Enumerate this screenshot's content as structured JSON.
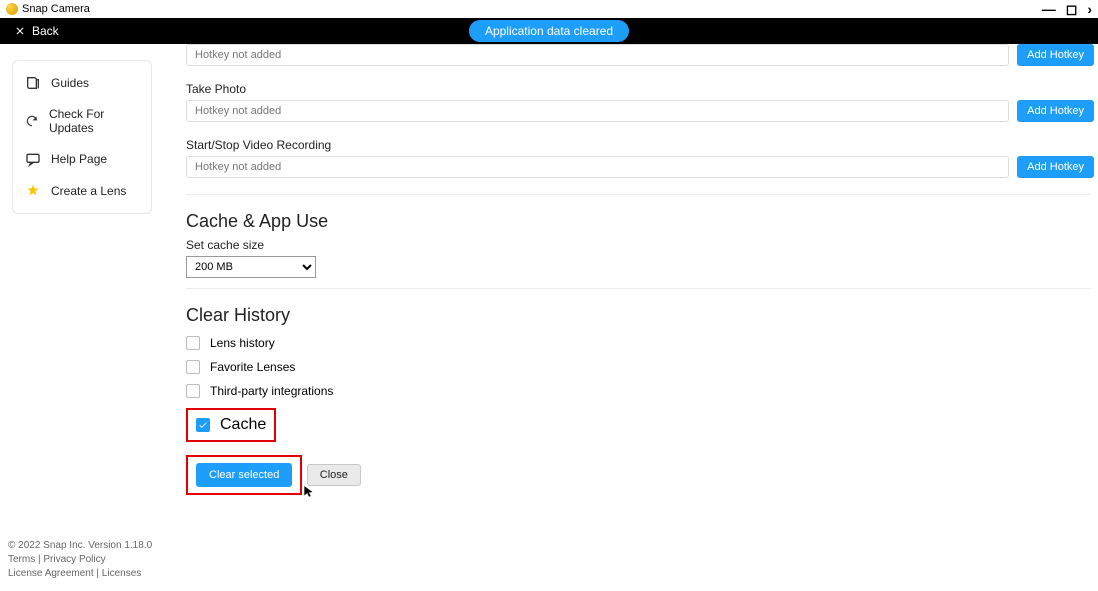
{
  "titlebar": {
    "app_name": "Snap Camera"
  },
  "banner": {
    "back_label": "Back",
    "toast": "Application data cleared"
  },
  "sidebar": {
    "items": [
      {
        "label": "Guides"
      },
      {
        "label": "Check For Updates"
      },
      {
        "label": "Help Page"
      },
      {
        "label": "Create a Lens"
      }
    ]
  },
  "hotkeys": {
    "placeholder": "Hotkey not added",
    "add_label": "Add Hotkey",
    "rows": [
      {
        "label": ""
      },
      {
        "label": "Take Photo"
      },
      {
        "label": "Start/Stop Video Recording"
      }
    ]
  },
  "cache": {
    "title": "Cache & App Use",
    "set_label": "Set cache size",
    "selected": "200 MB"
  },
  "history": {
    "title": "Clear History",
    "options": [
      {
        "label": "Lens history",
        "checked": false
      },
      {
        "label": "Favorite Lenses",
        "checked": false
      },
      {
        "label": "Third-party integrations",
        "checked": false
      },
      {
        "label": "Cache",
        "checked": true
      }
    ],
    "clear_label": "Clear selected",
    "close_label": "Close"
  },
  "footer": {
    "copyright": "© 2022 Snap Inc. Version 1.18.0",
    "links": [
      "Terms",
      "Privacy Policy",
      "License Agreement",
      "Licenses"
    ]
  }
}
